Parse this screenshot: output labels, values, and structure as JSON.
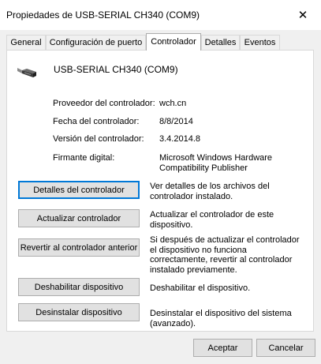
{
  "window": {
    "title": "Propiedades de USB-SERIAL CH340 (COM9)",
    "close_glyph": "✕"
  },
  "tabs": [
    {
      "label": "General"
    },
    {
      "label": "Configuración de puerto"
    },
    {
      "label": "Controlador",
      "active": true
    },
    {
      "label": "Detalles"
    },
    {
      "label": "Eventos"
    }
  ],
  "device": {
    "icon": "usb-cable-icon",
    "name": "USB-SERIAL CH340 (COM9)"
  },
  "info": [
    {
      "label": "Proveedor del controlador:",
      "value": "wch.cn"
    },
    {
      "label": "Fecha del controlador:",
      "value": "8/8/2014"
    },
    {
      "label": "Versión del controlador:",
      "value": "3.4.2014.8"
    },
    {
      "label": "Firmante digital:",
      "value": "Microsoft Windows Hardware Compatibility Publisher"
    }
  ],
  "actions": [
    {
      "button": "Detalles del controlador",
      "description": "Ver detalles de los archivos del controlador instalado."
    },
    {
      "button": "Actualizar controlador",
      "description": "Actualizar el controlador de este dispositivo."
    },
    {
      "button": "Revertir al controlador anterior",
      "description": "Si después de actualizar el controlador el dispositivo no funciona correctamente, revertir al controlador instalado previamente."
    },
    {
      "button": "Deshabilitar dispositivo",
      "description": "Deshabilitar el dispositivo."
    },
    {
      "button": "Desinstalar dispositivo",
      "description": "Desinstalar el dispositivo del sistema (avanzado)."
    }
  ],
  "footer": {
    "ok_label": "Aceptar",
    "cancel_label": "Cancelar"
  },
  "colors": {
    "focus_border": "#0078d7",
    "button_face": "#e1e1e1",
    "window_bg": "#f0f0f0"
  }
}
